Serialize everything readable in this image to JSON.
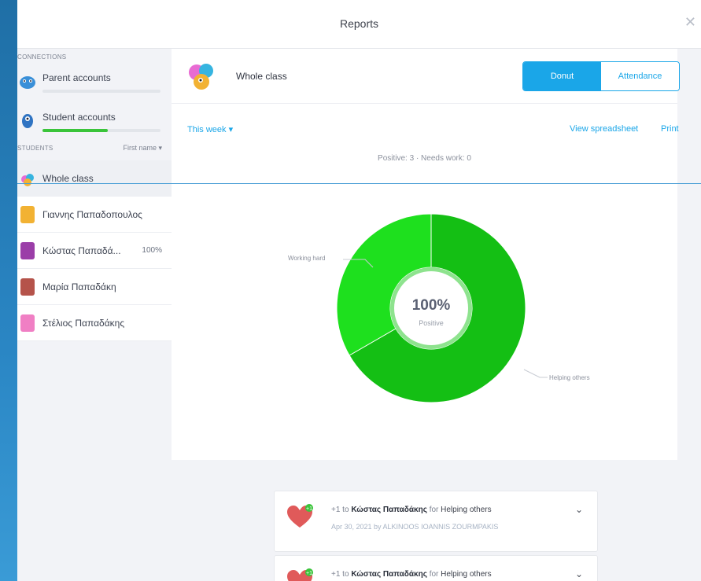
{
  "window": {
    "title": "Reports",
    "close_glyph": "✕"
  },
  "sidebar": {
    "connections_label": "CONNECTIONS",
    "accounts": [
      {
        "label": "Parent accounts",
        "progress": 0.0,
        "icon": "parents-icon"
      },
      {
        "label": "Student accounts",
        "progress": 0.55,
        "icon": "student-account-icon"
      }
    ],
    "students_label": "STUDENTS",
    "sort_label": "First name ▾",
    "students": [
      {
        "name": "Whole class",
        "pct": "",
        "color": "#e86bd3",
        "icon": "whole-class-avatar"
      },
      {
        "name": "Γιαννης Παπαδοπουλος",
        "pct": "",
        "color": "#f2b233",
        "icon": "student-avatar"
      },
      {
        "name": "Κώστας Παπαδά...",
        "pct": "100%",
        "color": "#9b3ea8",
        "icon": "student-avatar"
      },
      {
        "name": "Μαρία Παπαδάκη",
        "pct": "",
        "color": "#b5534a",
        "icon": "student-avatar"
      },
      {
        "name": "Στέλιος Παπαδάκης",
        "pct": "",
        "color": "#f07fc4",
        "icon": "student-avatar"
      }
    ]
  },
  "main": {
    "target": "Whole class",
    "toggle": {
      "donut": "Donut",
      "attendance": "Attendance"
    },
    "range": "This week ▾",
    "view_spreadsheet": "View spreadsheet",
    "print": "Print",
    "summary": "Positive: 3 · Needs work: 0"
  },
  "chart_data": {
    "type": "pie",
    "center_value": "100%",
    "center_label": "Positive",
    "slices": [
      {
        "label": "Working hard",
        "value": 1,
        "color": "#1ee01e"
      },
      {
        "label": "Helping others",
        "value": 2,
        "color": "#14bf14"
      }
    ]
  },
  "feed": [
    {
      "prefix": "+1 to",
      "student": "Κώστας Παπαδάκης",
      "for_word": "for",
      "behavior": "Helping others",
      "meta": "Apr 30, 2021 by ALKINOOS IOANNIS ZOURMPAKIS"
    },
    {
      "prefix": "+1 to",
      "student": "Κώστας Παπαδάκης",
      "for_word": "for",
      "behavior": "Helping others",
      "meta": ""
    }
  ]
}
